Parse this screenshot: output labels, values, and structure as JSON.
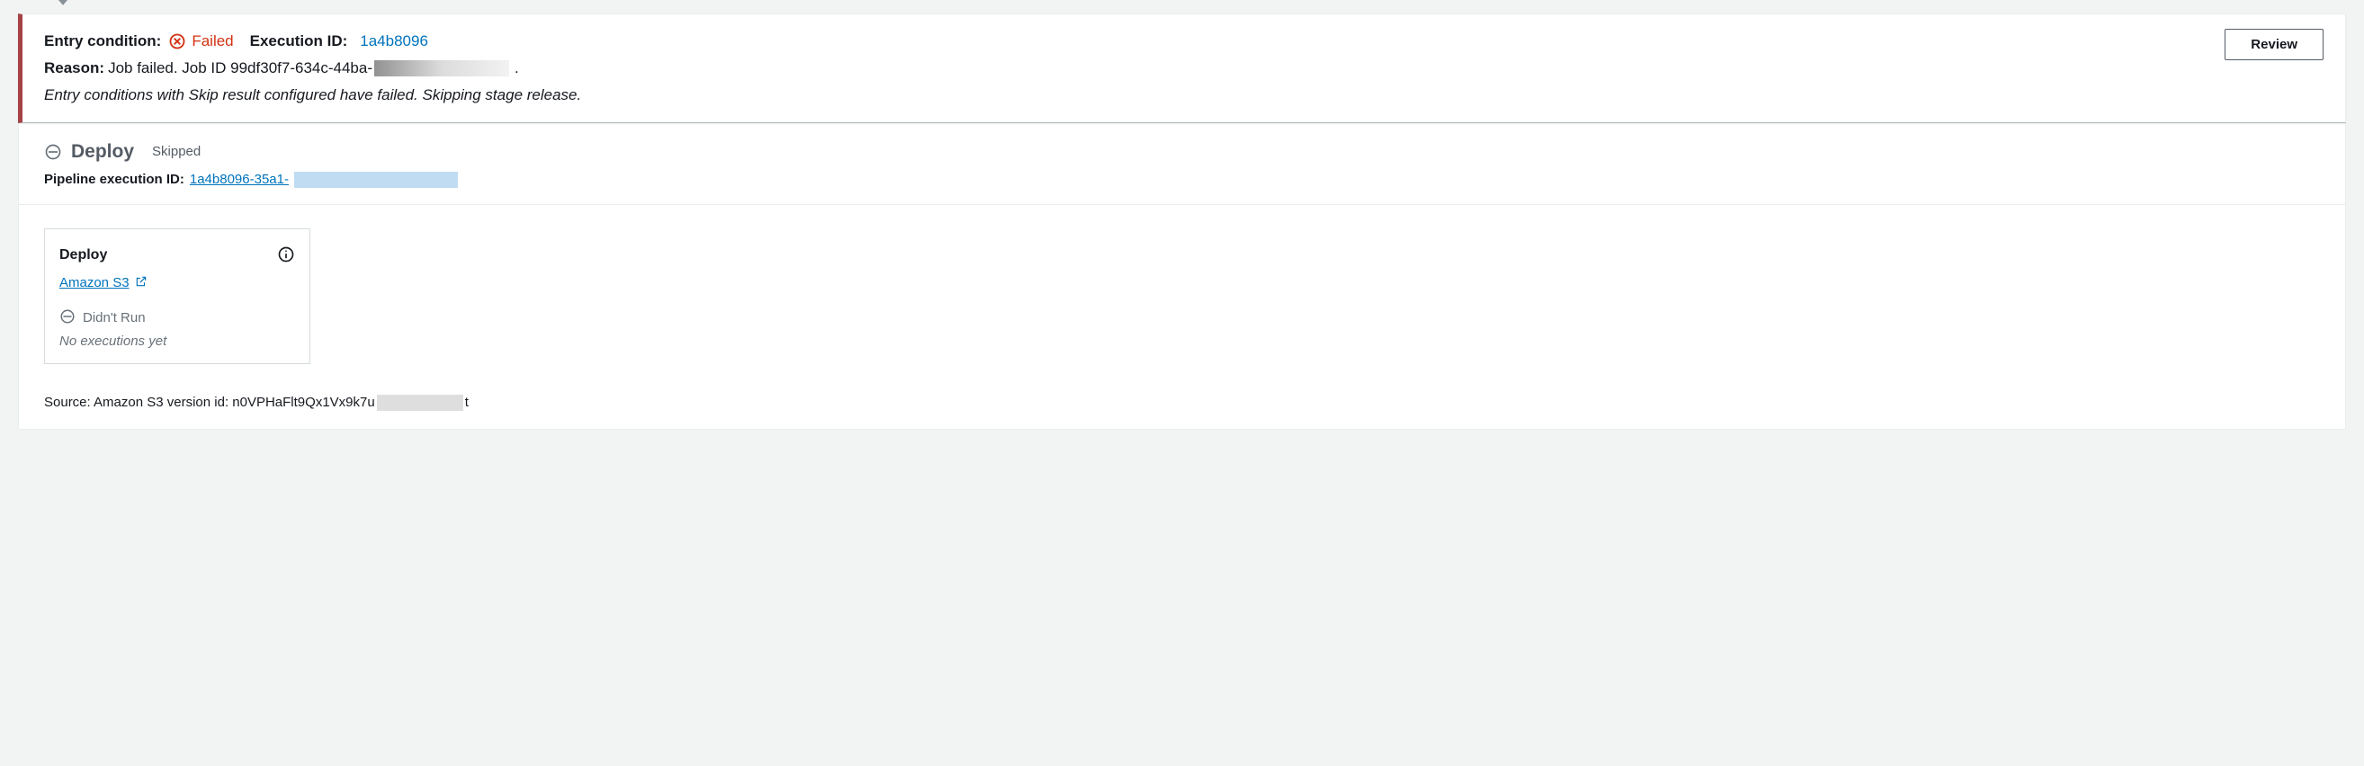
{
  "entry_condition": {
    "label": "Entry condition:",
    "status_text": "Failed",
    "execution_id_label": "Execution ID:",
    "execution_id": "1a4b8096",
    "reason_label": "Reason:",
    "reason_prefix": "Job failed. Job ID 99df30f7-634c-44ba-",
    "reason_suffix": ".",
    "skip_message": "Entry conditions with Skip result configured have failed. Skipping stage release.",
    "review_button": "Review"
  },
  "stage": {
    "name": "Deploy",
    "status": "Skipped",
    "pipeline_execution_id_label": "Pipeline execution ID:",
    "pipeline_execution_id_prefix": "1a4b8096-35a1-"
  },
  "action_card": {
    "title": "Deploy",
    "provider_link": "Amazon S3",
    "didnt_run_text": "Didn't Run",
    "no_executions_text": "No executions yet"
  },
  "source": {
    "prefix": "Source: Amazon S3 version id: n0VPHaFlt9Qx1Vx9k7u",
    "suffix": "t"
  }
}
